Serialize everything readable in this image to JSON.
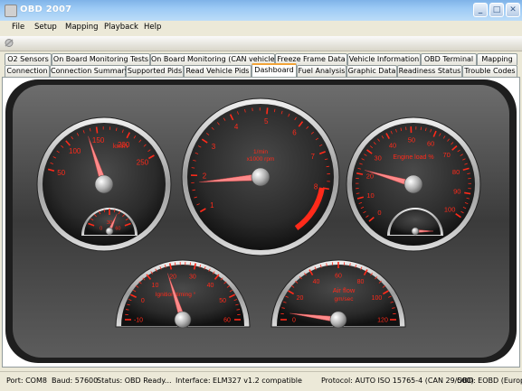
{
  "window": {
    "title": "OBD 2007"
  },
  "menu": [
    "File",
    "Setup",
    "Mapping",
    "Playback",
    "Help"
  ],
  "tabs_row1": [
    "O2 Sensors",
    "On Board Monitoring Tests",
    "On Board Monitoring (CAN vehicles)",
    "Freeze Frame Data",
    "Vehicle Information",
    "OBD Terminal",
    "Mapping"
  ],
  "tabs_row2": [
    "Connection",
    "Connection Summary",
    "Supported Pids",
    "Read Vehicle Pids",
    "Dashboard",
    "Fuel Analysis",
    "Graphic Data",
    "Readiness Status",
    "Trouble Codes"
  ],
  "active_tab": "Dashboard",
  "gauges": {
    "speed": {
      "unit": "km/h",
      "ticks": [
        "50",
        "100",
        "150",
        "200",
        "250"
      ],
      "value": 105,
      "max": 250,
      "mini_ticks": [
        "0",
        "30",
        "60"
      ],
      "mini_value": 40
    },
    "rpm": {
      "unit_line1": "1/min",
      "unit_line2": "x1000 rpm",
      "ticks": [
        "1",
        "2",
        "3",
        "4",
        "5",
        "6",
        "7",
        "8"
      ],
      "value": 1.8,
      "max": 8
    },
    "load": {
      "label": "Engine load %",
      "ticks": [
        "0",
        "10",
        "20",
        "30",
        "40",
        "50",
        "60",
        "70",
        "80",
        "90",
        "100"
      ],
      "value": 22,
      "max": 100,
      "mini_value": 50
    },
    "timing": {
      "label": "Ignition timing °",
      "ticks": [
        "-10",
        "0",
        "10",
        "20",
        "30",
        "40",
        "50",
        "60"
      ],
      "value": 18
    },
    "airflow": {
      "label_line1": "Air flow",
      "label_line2": "gm/sec",
      "ticks": [
        "0",
        "20",
        "40",
        "60",
        "80",
        "100",
        "120"
      ],
      "value": 5
    }
  },
  "status": {
    "port": "Port: COM8",
    "baud": "Baud: 57600",
    "state": "Status: OBD Ready...",
    "interface": "Interface: ELM327 v1.2 compatible",
    "protocol": "Protocol: AUTO ISO 15765-4 (CAN 29/500)",
    "obd": "OBD: EOBD (Europe)"
  },
  "colors": {
    "accent_red": "#ff2a1a",
    "needle": "#ff8a8a",
    "title_bar": "#8fc0ef"
  }
}
